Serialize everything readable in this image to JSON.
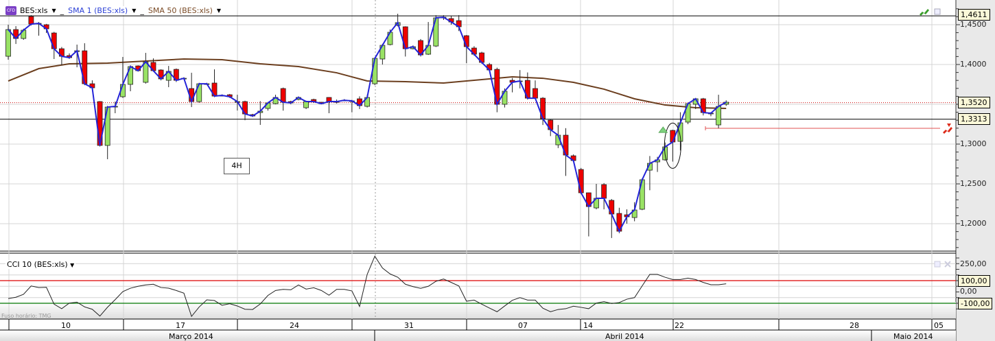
{
  "legend": {
    "instrument_badge": "CFD",
    "instrument": "BES:xls",
    "sma1": "SMA 1 (BES:xls)",
    "sma50": "SMA 50 (BES:xls)",
    "cci": "CCI 10 (BES:xls)",
    "caret": "▼",
    "separator": "_"
  },
  "timeframe_label": "4H",
  "timezone_label": "Fuso horário: TMG",
  "colors": {
    "up": "#99e265",
    "down": "#ee0000",
    "sma1": "#2323d8",
    "sma50": "#6b3e1e",
    "cci": "#222222",
    "cci_upper": "#dd0000",
    "cci_lower": "#007700",
    "sma1_legend": "#2a3fd6",
    "sma50_legend": "#7a4a25"
  },
  "chart_data": [
    {
      "type": "candlestick",
      "title": "BES:xls 4H",
      "ylim": [
        1.166,
        1.481
      ],
      "y_ticks": [
        "1,4500",
        "1,4000",
        "1,3000",
        "1,2500",
        "1,2000"
      ],
      "y_tick_values": [
        1.45,
        1.4,
        1.3,
        1.25,
        1.2
      ],
      "price_markers": [
        {
          "label": "1,4611",
          "value": 1.4611,
          "style": "solid-black"
        },
        {
          "label": "1,3520",
          "value": 1.352,
          "style": "dotted-red"
        },
        {
          "label": "1,3313",
          "value": 1.3313,
          "style": "solid-black"
        }
      ],
      "alert_line_value": 1.3198,
      "candles_ohlc": [
        [
          1.4103,
          1.45,
          1.406,
          1.4439
        ],
        [
          1.4439,
          1.4482,
          1.4258,
          1.4327
        ],
        [
          1.4327,
          1.445,
          1.431,
          1.4431
        ],
        [
          1.4603,
          1.462,
          1.449,
          1.4508
        ],
        [
          1.4517,
          1.4534,
          1.4362,
          1.4517
        ],
        [
          1.45,
          1.451,
          1.4396,
          1.4448
        ],
        [
          1.4396,
          1.441,
          1.4069,
          1.4198
        ],
        [
          1.4198,
          1.422,
          1.3991,
          1.4103
        ],
        [
          1.4112,
          1.414,
          1.407,
          1.4086
        ],
        [
          1.4172,
          1.425,
          1.3965,
          1.4172
        ],
        [
          1.4172,
          1.4267,
          1.374,
          1.3758
        ],
        [
          1.3758,
          1.3801,
          1.369,
          1.3707
        ],
        [
          1.3534,
          1.354,
          1.297,
          1.2983
        ],
        [
          1.2983,
          1.348,
          1.281,
          1.3465
        ],
        [
          1.3474,
          1.3534,
          1.3388,
          1.3474
        ],
        [
          1.3595,
          1.4095,
          1.358,
          1.375
        ],
        [
          1.375,
          1.399,
          1.3664,
          1.3974
        ],
        [
          1.3982,
          1.399,
          1.391,
          1.3922
        ],
        [
          1.3776,
          1.4146,
          1.376,
          1.4034
        ],
        [
          1.4026,
          1.4077,
          1.391,
          1.3922
        ],
        [
          1.3931,
          1.394,
          1.38,
          1.3819
        ],
        [
          1.3801,
          1.3982,
          1.3715,
          1.3914
        ],
        [
          1.3939,
          1.395,
          1.378,
          1.3801
        ],
        [
          1.3827,
          1.384,
          1.381,
          1.3827
        ],
        [
          1.3698,
          1.3896,
          1.3465,
          1.3534
        ],
        [
          1.3534,
          1.377,
          1.352,
          1.3758
        ],
        [
          1.3758,
          1.377,
          1.3745,
          1.3758
        ],
        [
          1.3767,
          1.3939,
          1.359,
          1.3603
        ],
        [
          1.3612,
          1.3625,
          1.36,
          1.3612
        ],
        [
          1.362,
          1.363,
          1.358,
          1.3595
        ],
        [
          1.3534,
          1.362,
          1.3422,
          1.3534
        ],
        [
          1.3534,
          1.3545,
          1.33,
          1.3379
        ],
        [
          1.337,
          1.338,
          1.334,
          1.3353
        ],
        [
          1.3396,
          1.354,
          1.3241,
          1.3414
        ],
        [
          1.3448,
          1.353,
          1.342,
          1.3517
        ],
        [
          1.3508,
          1.362,
          1.35,
          1.3586
        ],
        [
          1.3698,
          1.371,
          1.342,
          1.3526
        ],
        [
          1.3534,
          1.3545,
          1.35,
          1.3517
        ],
        [
          1.356,
          1.36,
          1.355,
          1.3586
        ],
        [
          1.3457,
          1.3545,
          1.344,
          1.3534
        ],
        [
          1.356,
          1.357,
          1.352,
          1.3534
        ],
        [
          1.3526,
          1.353,
          1.35,
          1.3508
        ],
        [
          1.3586,
          1.359,
          1.3388,
          1.3534
        ],
        [
          1.3534,
          1.356,
          1.351,
          1.3534
        ],
        [
          1.3551,
          1.3565,
          1.354,
          1.3551
        ],
        [
          1.3543,
          1.3555,
          1.34,
          1.3543
        ],
        [
          1.3569,
          1.36,
          1.344,
          1.3483
        ],
        [
          1.3474,
          1.362,
          1.346,
          1.3586
        ],
        [
          1.3758,
          1.409,
          1.374,
          1.4077
        ],
        [
          1.4069,
          1.426,
          1.4,
          1.4241
        ],
        [
          1.425,
          1.444,
          1.424,
          1.4405
        ],
        [
          1.4491,
          1.4638,
          1.448,
          1.4526
        ],
        [
          1.4474,
          1.448,
          1.41,
          1.4198
        ],
        [
          1.4198,
          1.424,
          1.419,
          1.4224
        ],
        [
          1.4301,
          1.432,
          1.41,
          1.412
        ],
        [
          1.4129,
          1.4534,
          1.412,
          1.4241
        ],
        [
          1.4232,
          1.462,
          1.422,
          1.4586
        ],
        [
          1.4594,
          1.462,
          1.456,
          1.4594
        ],
        [
          1.4577,
          1.461,
          1.45,
          1.4534
        ],
        [
          1.4551,
          1.462,
          1.442,
          1.4474
        ],
        [
          1.4362,
          1.437,
          1.4017,
          1.4224
        ],
        [
          1.4207,
          1.423,
          1.411,
          1.4129
        ],
        [
          1.4146,
          1.416,
          1.401,
          1.4026
        ],
        [
          1.4,
          1.402,
          1.392,
          1.3931
        ],
        [
          1.3939,
          1.396,
          1.34,
          1.35
        ],
        [
          1.35,
          1.37,
          1.346,
          1.3664
        ],
        [
          1.3801,
          1.383,
          1.365,
          1.3776
        ],
        [
          1.3793,
          1.393,
          1.37,
          1.3793
        ],
        [
          1.3801,
          1.39,
          1.356,
          1.3577
        ],
        [
          1.3698,
          1.38,
          1.356,
          1.3577
        ],
        [
          1.3577,
          1.359,
          1.324,
          1.3319
        ],
        [
          1.3301,
          1.331,
          1.31,
          1.3181
        ],
        [
          1.2991,
          1.324,
          1.295,
          1.3112
        ],
        [
          1.3112,
          1.32,
          1.26,
          1.2862
        ],
        [
          1.2853,
          1.287,
          1.278,
          1.2793
        ],
        [
          1.2681,
          1.27,
          1.237,
          1.2388
        ],
        [
          1.2388,
          1.239,
          1.184,
          1.2215
        ],
        [
          1.2198,
          1.25,
          1.218,
          1.2319
        ],
        [
          1.2491,
          1.251,
          1.218,
          1.2319
        ],
        [
          1.2293,
          1.231,
          1.182,
          1.2121
        ],
        [
          1.2129,
          1.22,
          1.188,
          1.1905
        ],
        [
          1.2112,
          1.218,
          1.2,
          1.2086
        ],
        [
          1.2077,
          1.227,
          1.203,
          1.2172
        ],
        [
          1.2181,
          1.257,
          1.217,
          1.2552
        ],
        [
          1.2672,
          1.285,
          1.242,
          1.2758
        ],
        [
          1.2776,
          1.284,
          1.265,
          1.2802
        ],
        [
          1.2802,
          1.302,
          1.279,
          1.2965
        ],
        [
          1.3172,
          1.318,
          1.278,
          1.3026
        ],
        [
          1.3034,
          1.34,
          1.292,
          1.3267
        ],
        [
          1.3276,
          1.352,
          1.325,
          1.3508
        ],
        [
          1.35,
          1.358,
          1.344,
          1.3569
        ],
        [
          1.3569,
          1.358,
          1.336,
          1.3396
        ],
        [
          1.3388,
          1.34,
          1.335,
          1.3388
        ],
        [
          1.3241,
          1.362,
          1.32,
          1.3474
        ],
        [
          1.35,
          1.355,
          1.348,
          1.3526
        ]
      ],
      "sma50_points": [
        [
          0,
          1.3793
        ],
        [
          4,
          1.3948
        ],
        [
          8,
          1.4009
        ],
        [
          13,
          1.4017
        ],
        [
          18,
          1.4043
        ],
        [
          23,
          1.4069
        ],
        [
          28,
          1.406
        ],
        [
          33,
          1.4009
        ],
        [
          38,
          1.3974
        ],
        [
          43,
          1.3896
        ],
        [
          47,
          1.3793
        ],
        [
          52,
          1.3784
        ],
        [
          57,
          1.3767
        ],
        [
          62,
          1.381
        ],
        [
          66,
          1.3845
        ],
        [
          70,
          1.3827
        ],
        [
          74,
          1.3776
        ],
        [
          78,
          1.369
        ],
        [
          82,
          1.3569
        ],
        [
          86,
          1.3491
        ],
        [
          90,
          1.3457
        ],
        [
          94,
          1.3448
        ]
      ],
      "signal_candle_index": 87
    },
    {
      "type": "line",
      "title": "CCI 10 (BES:xls)",
      "ylim": [
        -250,
        330
      ],
      "y_ticks": [
        "250,00",
        "0,00"
      ],
      "y_tick_values": [
        250,
        0
      ],
      "levels": [
        {
          "label": "100,00",
          "value": 100
        },
        {
          "label": "-100,00",
          "value": -100
        }
      ],
      "values": [
        -58,
        -47,
        -21,
        53,
        39,
        41,
        -108,
        -148,
        -98,
        -90,
        -132,
        -153,
        -213,
        -135,
        -68,
        3,
        33,
        50,
        62,
        68,
        39,
        33,
        13,
        -11,
        -216,
        -133,
        -70,
        -76,
        -118,
        -104,
        -124,
        -153,
        -155,
        -106,
        -31,
        13,
        23,
        19,
        62,
        25,
        37,
        13,
        -29,
        23,
        23,
        9,
        -128,
        155,
        316,
        211,
        159,
        130,
        68,
        47,
        32,
        50,
        94,
        114,
        84,
        53,
        -82,
        -72,
        -108,
        -142,
        -175,
        -124,
        -74,
        -50,
        -72,
        -72,
        -144,
        -175,
        -155,
        -148,
        -126,
        -136,
        -148,
        -98,
        -86,
        -102,
        -94,
        -64,
        -50,
        53,
        155,
        155,
        130,
        110,
        110,
        122,
        110,
        84,
        64,
        64,
        72
      ]
    }
  ],
  "x_axis": {
    "days": [
      "10",
      "17",
      "24",
      "31",
      "07",
      "14",
      "22",
      "28",
      "05"
    ],
    "months": [
      "Março 2014",
      "Abril 2014",
      "Maio 2014"
    ]
  }
}
